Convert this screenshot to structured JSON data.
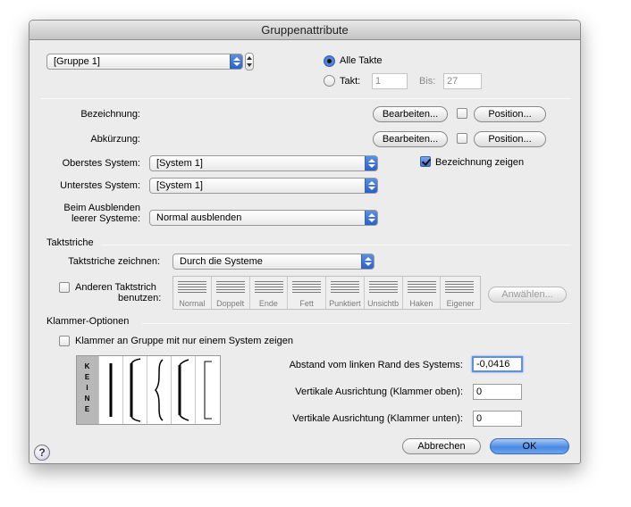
{
  "window": {
    "title": "Gruppenattribute"
  },
  "group": {
    "selected": "[Gruppe 1]"
  },
  "range": {
    "all_label": "Alle Takte",
    "takt_label": "Takt:",
    "takt_value": "1",
    "bis_label": "Bis:",
    "bis_value": "27"
  },
  "names": {
    "bezeichnung_label": "Bezeichnung:",
    "abkuerzung_label": "Abkürzung:",
    "edit_label": "Bearbeiten...",
    "position_label": "Position...",
    "show_label": "Bezeichnung zeigen"
  },
  "systems": {
    "top_label": "Oberstes System:",
    "top_value": "[System 1]",
    "bottom_label": "Unterstes System:",
    "bottom_value": "[System 1]",
    "hide_label_1": "Beim Ausblenden",
    "hide_label_2": "leerer Systeme:",
    "hide_value": "Normal ausblenden"
  },
  "barlines": {
    "section_title": "Taktstriche",
    "draw_label": "Taktstriche zeichnen:",
    "draw_value": "Durch die Systeme",
    "other_label_1": "Anderen Taktstrich",
    "other_label_2": "benutzen:",
    "choose_label": "Anwählen...",
    "styles": [
      "Normal",
      "Doppelt",
      "Ende",
      "Fett",
      "Punktiert",
      "Unsichtb",
      "Haken",
      "Eigener"
    ]
  },
  "brackets": {
    "section_title": "Klammer-Optionen",
    "single_label": "Klammer an Gruppe mit nur einem System zeigen",
    "none_label": "KEINE",
    "offset_label": "Abstand vom linken Rand des Systems:",
    "offset_value": "-0,0416",
    "top_label": "Vertikale Ausrichtung (Klammer oben):",
    "top_value": "0",
    "bottom_label": "Vertikale Ausrichtung (Klammer unten):",
    "bottom_value": "0"
  },
  "footer": {
    "help_label": "?",
    "cancel_label": "Abbrechen",
    "ok_label": "OK"
  }
}
